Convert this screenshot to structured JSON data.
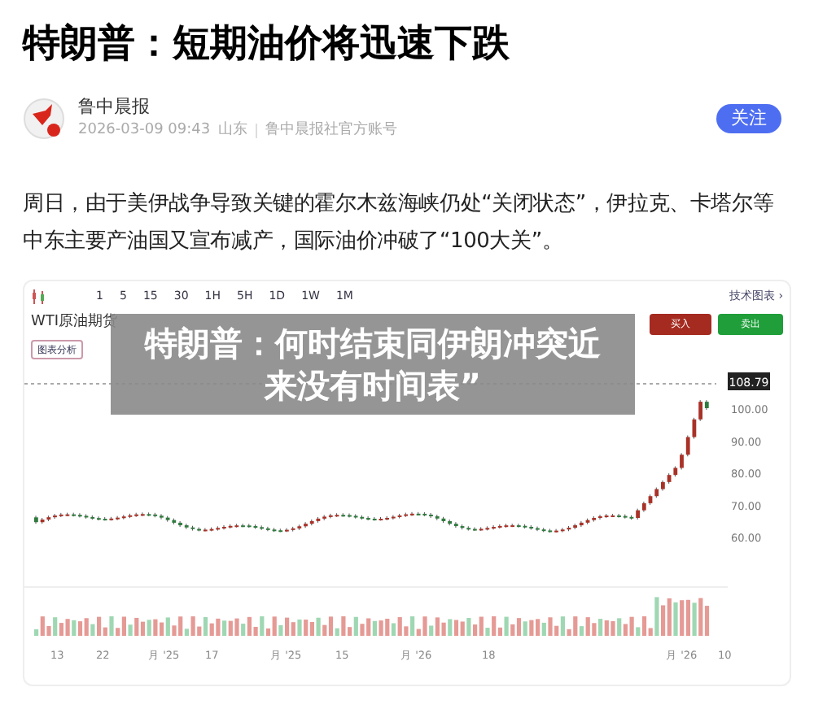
{
  "headline": "特朗普：短期油价将迅速下跌",
  "author": {
    "name": "鲁中晨报",
    "date": "2026-03-09 09:43",
    "region": "山东",
    "account": "鲁中晨报社官方账号",
    "follow_button": "关注"
  },
  "body": "周日，由于美伊战争导致关键的霍尔木兹海峡仍处“关闭状态”，伊拉克、卡塔尔等中东主要产油国又宣布减产，国际油价冲破了“100大关”。",
  "chart_screenshot": {
    "intervals": [
      "1",
      "5",
      "15",
      "30",
      "1H",
      "5H",
      "1D",
      "1W",
      "1M"
    ],
    "tech_chart_link": "技术图表 ›",
    "instrument": "WTI原油期货",
    "analysis_button": "图表分析",
    "buy_button": "买入",
    "sell_button": "卖出",
    "last_price": "108.79",
    "y_labels": [
      "100.00",
      "90.00",
      "80.00",
      "70.00",
      "60.00"
    ],
    "x_labels": [
      "13",
      "22",
      "月 '25",
      "17",
      "月 '25",
      "15",
      "月 '26",
      "18",
      "月 '26",
      "10"
    ]
  },
  "overlay_caption": "特朗普：何时结束同伊朗冲突近来没有时间表”"
}
